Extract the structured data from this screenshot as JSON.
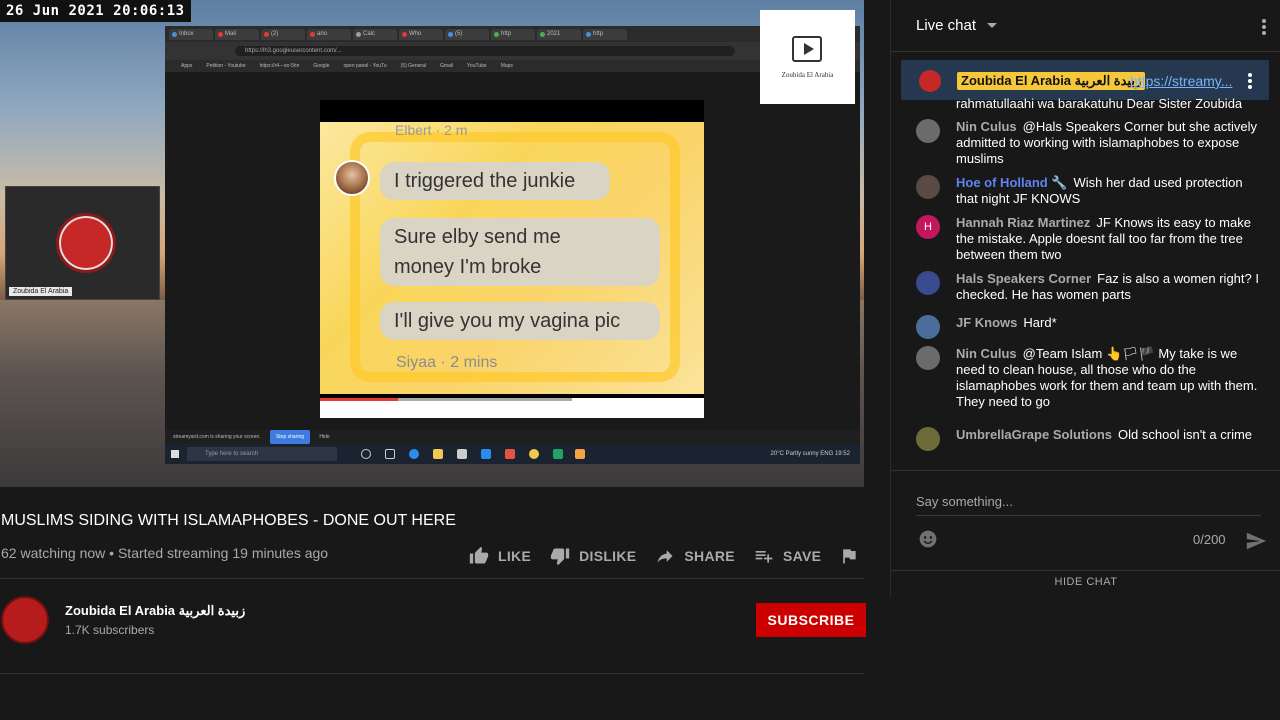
{
  "video": {
    "timestamp": "26 Jun 2021 20:06:13",
    "logo_card_name": "Zoubida El Arabia",
    "cam_label": "Zoubida El Arabia",
    "screenshot": {
      "elbert": "Elbert · 2 m",
      "bubble1": "I triggered the junkie",
      "bubble2_line1": "Sure elby send me",
      "bubble2_line2": "money I'm broke",
      "bubble3": "I'll give you my vagina pic",
      "siyaa": "Siyaa · 2 mins"
    },
    "taskbar_search": "Type here to search",
    "tray_text": "20°C Partly sunny  ENG  19:52",
    "share_notice": "streamyard.com is sharing your screen.",
    "stop_sharing": "Stop sharing",
    "hide": "Hide"
  },
  "title": "MUSLIMS SIDING WITH ISLAMAPHOBES - DONE OUT HERE",
  "meta": "62 watching now • Started streaming 19 minutes ago",
  "actions": {
    "like": "LIKE",
    "dislike": "DISLIKE",
    "share": "SHARE",
    "save": "SAVE"
  },
  "channel": {
    "name": "Zoubida El Arabia زبيدة العربية",
    "subscribers": "1.7K subscribers",
    "subscribe_label": "SUBSCRIBE"
  },
  "chat": {
    "header": "Live chat",
    "pinned": {
      "author": "Zoubida El Arabia زبيدة العربية",
      "link": "https://streamy...",
      "tail": "rahmatullaahi wa barakatuhu Dear Sister Zoubida"
    },
    "messages": [
      {
        "author": "Nin Culus",
        "text": "@Hals Speakers Corner but she actively admitted to working with islamaphobes to expose muslims"
      },
      {
        "author": "Hoe of Holland 🔧",
        "text": "Wish her dad used protection that night JF KNOWS"
      },
      {
        "author": "Hannah Riaz Martinez",
        "text": "JF Knows its easy to make the mistake. Apple doesnt fall too far from the tree between them two",
        "initial": "H"
      },
      {
        "author": "Hals Speakers Corner",
        "text": "Faz is also a women right? I checked. He has women parts"
      },
      {
        "author": "JF Knows",
        "text": "Hard*"
      },
      {
        "author": "Nin Culus",
        "text": "@Team Islam 👆🏳🏴 My take is we need to clean house, all those who do the islamaphobes work for them and team up with them. They need to go"
      },
      {
        "author": "UmbrellaGrape Solutions",
        "text": "Old school isn't a crime"
      }
    ],
    "input_placeholder": "Say something...",
    "char_count": "0/200",
    "hide_chat": "HIDE CHAT"
  },
  "colors": {
    "subscribe": "#cc0000",
    "pinned_bg": "#263850",
    "author_badge": "#f7c73a",
    "link": "#7ab3f7"
  }
}
